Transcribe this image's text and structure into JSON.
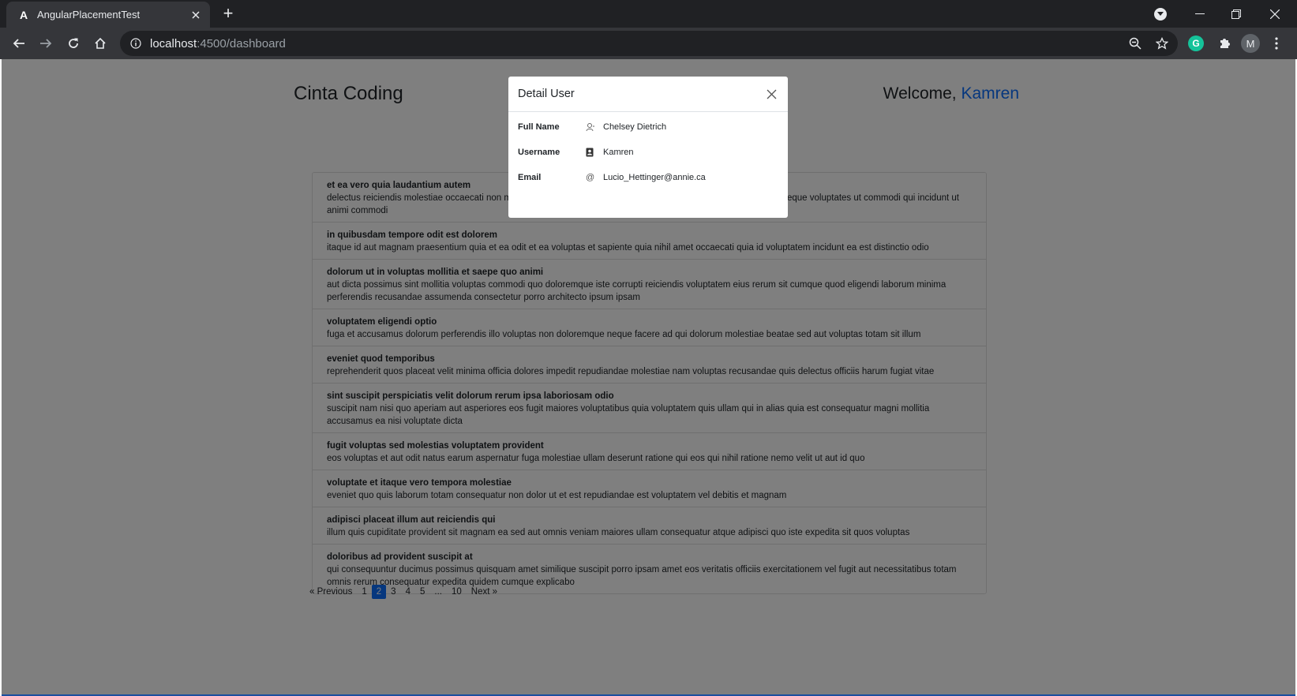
{
  "browser": {
    "tab_title": "AngularPlacementTest",
    "favicon_letter": "A",
    "url_host": "localhost",
    "url_rest": ":4500/dashboard",
    "extension_letter": "G",
    "profile_initial": "M"
  },
  "header": {
    "brand": "Cinta Coding",
    "welcome_prefix": "Welcome, ",
    "username": "Kamren"
  },
  "posts": [
    {
      "title": "et ea vero quia laudantium autem",
      "body": "delectus reiciendis molestiae occaecati non minima eveniet qui voluptatibus accusamus in eum beatae sit vel qui neque voluptates ut commodi qui incidunt ut animi commodi"
    },
    {
      "title": "in quibusdam tempore odit est dolorem",
      "body": "itaque id aut magnam praesentium quia et ea odit et ea voluptas et sapiente quia nihil amet occaecati quia id voluptatem incidunt ea est distinctio odio"
    },
    {
      "title": "dolorum ut in voluptas mollitia et saepe quo animi",
      "body": "aut dicta possimus sint mollitia voluptas commodi quo doloremque iste corrupti reiciendis voluptatem eius rerum sit cumque quod eligendi laborum minima perferendis recusandae assumenda consectetur porro architecto ipsum ipsam"
    },
    {
      "title": "voluptatem eligendi optio",
      "body": "fuga et accusamus dolorum perferendis illo voluptas non doloremque neque facere ad qui dolorum molestiae beatae sed aut voluptas totam sit illum"
    },
    {
      "title": "eveniet quod temporibus",
      "body": "reprehenderit quos placeat velit minima officia dolores impedit repudiandae molestiae nam voluptas recusandae quis delectus officiis harum fugiat vitae"
    },
    {
      "title": "sint suscipit perspiciatis velit dolorum rerum ipsa laboriosam odio",
      "body": "suscipit nam nisi quo aperiam aut asperiores eos fugit maiores voluptatibus quia voluptatem quis ullam qui in alias quia est consequatur magni mollitia accusamus ea nisi voluptate dicta"
    },
    {
      "title": "fugit voluptas sed molestias voluptatem provident",
      "body": "eos voluptas et aut odit natus earum aspernatur fuga molestiae ullam deserunt ratione qui eos qui nihil ratione nemo velit ut aut id quo"
    },
    {
      "title": "voluptate et itaque vero tempora molestiae",
      "body": "eveniet quo quis laborum totam consequatur non dolor ut et est repudiandae est voluptatem vel debitis et magnam"
    },
    {
      "title": "adipisci placeat illum aut reiciendis qui",
      "body": "illum quis cupiditate provident sit magnam ea sed aut omnis veniam maiores ullam consequatur atque adipisci quo iste expedita sit quos voluptas"
    },
    {
      "title": "doloribus ad provident suscipit at",
      "body": "qui consequuntur ducimus possimus quisquam amet similique suscipit porro ipsam amet eos veritatis officiis exercitationem vel fugit aut necessitatibus totam omnis rerum consequatur expedita quidem cumque explicabo"
    }
  ],
  "pagination": {
    "prev": "« Previous",
    "pages": [
      "1",
      "2",
      "3",
      "4",
      "5",
      "...",
      "10"
    ],
    "active": "2",
    "next": "Next »"
  },
  "modal": {
    "title": "Detail User",
    "fields": [
      {
        "label": "Full Name",
        "icon": "user-icon",
        "value": "Chelsey Dietrich"
      },
      {
        "label": "Username",
        "icon": "id-badge-icon",
        "value": "Kamren"
      },
      {
        "label": "Email",
        "icon": "at-icon",
        "value": "Lucio_Hettinger@annie.ca"
      }
    ]
  },
  "colors": {
    "accent": "#0d6efd",
    "chrome_dark": "#202124",
    "chrome_toolbar": "#35363a"
  }
}
